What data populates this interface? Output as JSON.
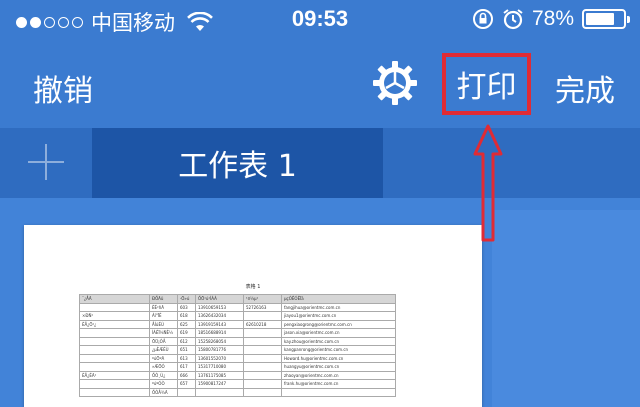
{
  "status_bar": {
    "carrier": "中国移动",
    "signal_dots": [
      true,
      true,
      false,
      false,
      false
    ],
    "time": "09:53",
    "battery_percent": "78%",
    "battery_level": 0.78
  },
  "nav": {
    "undo_label": "撤销",
    "print_label": "打印",
    "done_label": "完成"
  },
  "tabs": {
    "sheet_tab_label": "工作表 1"
  },
  "preview": {
    "table_title": "表格 1",
    "headers": [
      "ˇ¿ÅÃ",
      "ÐÕÃû",
      "·Ö»ú",
      "ÕÖ¹ú¹ÌÀÀ",
      "¹¤¼µ¹",
      "µçÓÊÓÊÏä"
    ],
    "rows": [
      [
        "",
        "ÈÉ²ñÃ",
        "603",
        "13910659153",
        "52726163",
        "fangjihua@orientmc.com.cn"
      ],
      [
        "×ÐÑ¹",
        "Àî°ÏÉ",
        "618",
        "13626432034",
        "",
        "jiayou1@orientmc.com.cn"
      ],
      [
        "ÈÅ¿Ö¹¿",
        "ÅÍúÉÚ",
        "625",
        "13919159143",
        "62610218",
        "pengxiaogrong@orientmc.com.cn"
      ],
      [
        "",
        "ÍÁÉÏ¼ÑÈ¼",
        "619",
        "18516688914",
        "",
        "jason.xia@orientmc.com.cn"
      ],
      [
        "",
        "ÖÜ¡ÓÅ",
        "612",
        "15258268054",
        "",
        "kay.zhou@orientmc.com.cn"
      ],
      [
        "",
        "¿µÈÆÉÙ",
        "651",
        "15800781776",
        "",
        "kangpanrong@orientmc.com.cn"
      ],
      [
        "",
        "ºúÖºÃ",
        "613",
        "13601552070",
        "",
        "Howard.hu@orientmc.com.cn"
      ],
      [
        "",
        "»ÆÖÓ",
        "617",
        "15317710080",
        "",
        "huangyu@orientmc.com.cn"
      ],
      [
        "ÈÅ¿ÉÃ¹",
        "ÕÔ¸Ú¿",
        "666",
        "13761175085",
        "",
        "zhaoyan@orientmc.com.cn"
      ],
      [
        "",
        "ºúºÓÒ",
        "657",
        "15900817247",
        "",
        "frank.hu@orientmc.com.cn"
      ],
      [
        "",
        "ÕÔÅ¾Ã",
        "",
        "",
        "",
        ""
      ]
    ]
  }
}
